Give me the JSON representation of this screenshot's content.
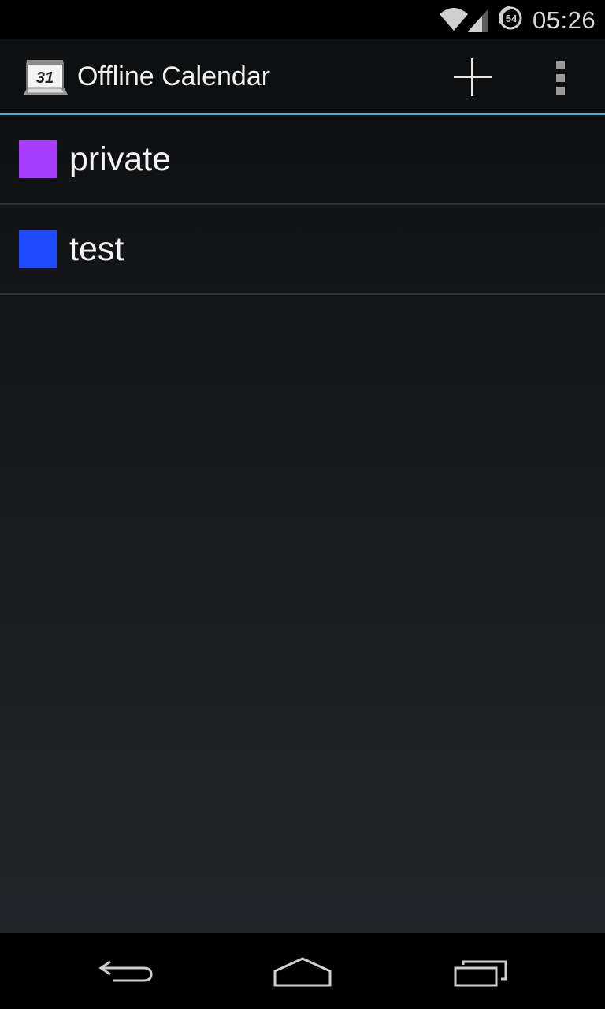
{
  "status_bar": {
    "time": "05:26",
    "data_badge": "54",
    "icons": [
      "wifi-icon",
      "signal-icon",
      "data-saver-icon"
    ]
  },
  "action_bar": {
    "title": "Offline Calendar",
    "app_icon_day": "31",
    "accent_color": "#33b5e5",
    "actions": [
      "add-icon",
      "overflow-menu-icon"
    ]
  },
  "calendars": [
    {
      "name": "private",
      "color": "#a83cff"
    },
    {
      "name": "test",
      "color": "#1f4bff"
    }
  ],
  "nav_bar": {
    "buttons": [
      "back-icon",
      "home-icon",
      "recents-icon"
    ]
  }
}
